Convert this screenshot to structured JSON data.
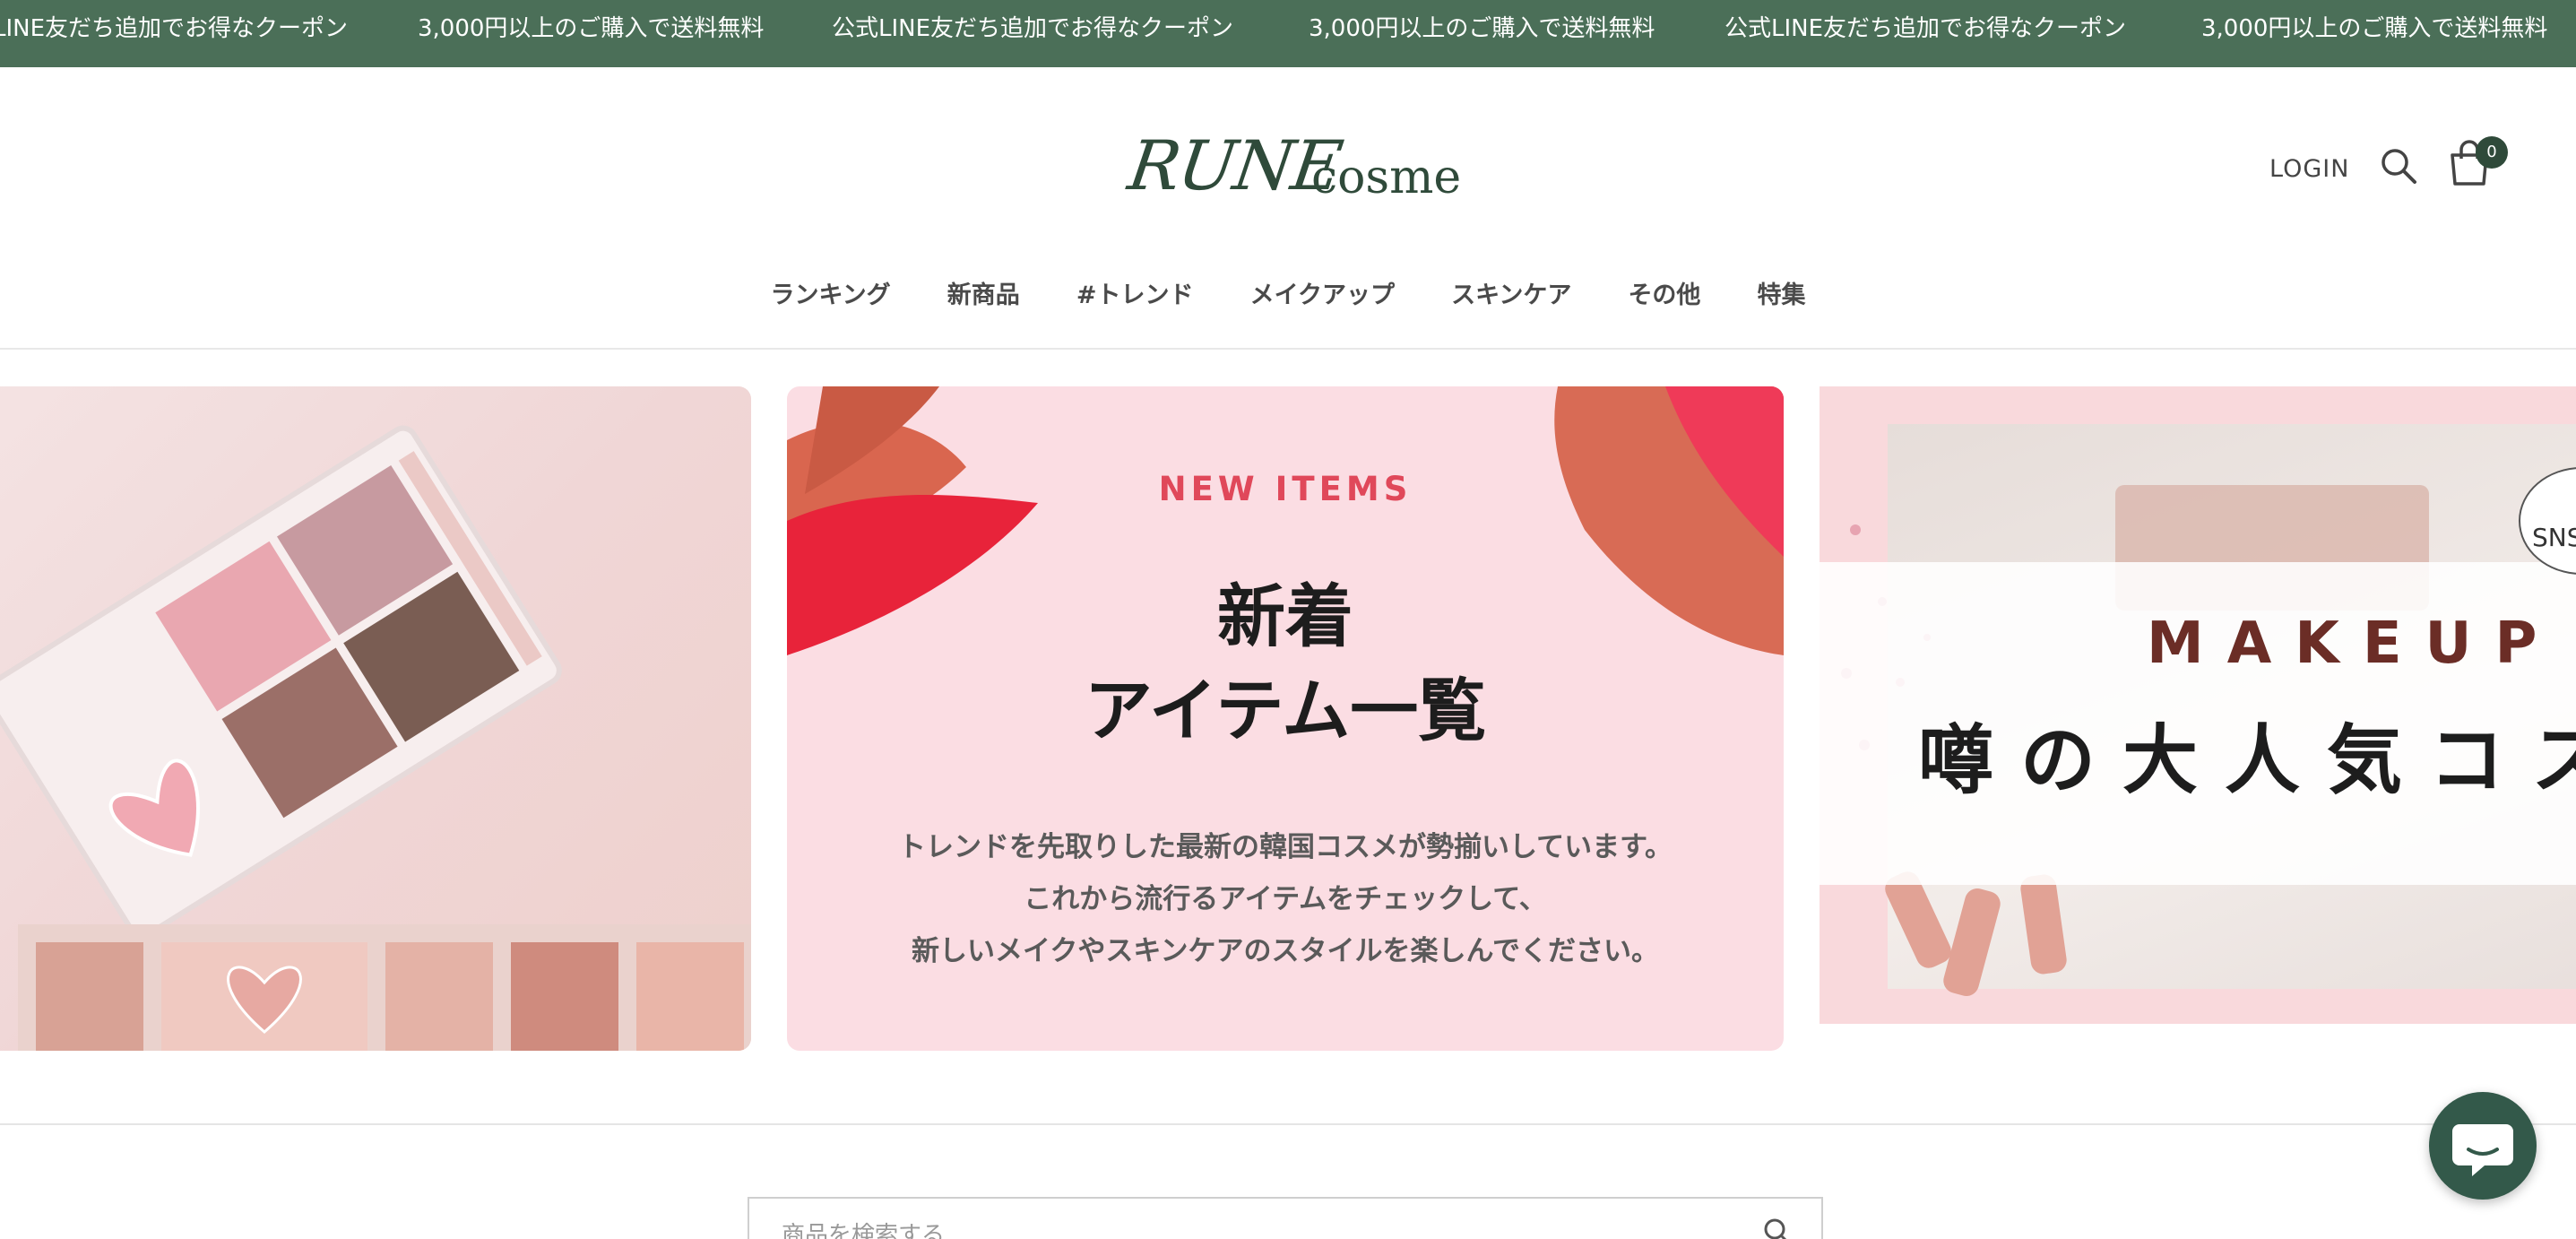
{
  "announcement": {
    "messages": [
      "LINE友だち追加でお得なクーポン",
      "3,000円以上のご購入で送料無料",
      "公式LINE友だち追加でお得なクーポン",
      "3,000円以上のご購入で送料無料",
      "公式LINE友だち追加でお得なクーポン",
      "3,000円以上のご購入で送料無料"
    ],
    "background": "#4b6f58"
  },
  "header": {
    "logo_script": "RUNE",
    "logo_word": "cosme",
    "login_label": "LOGIN",
    "cart_count": "0",
    "icons": [
      "search-icon",
      "cart-icon"
    ]
  },
  "nav": {
    "items": [
      "ランキング",
      "新商品",
      "#トレンド",
      "メイクアップ",
      "スキンケア",
      "その他",
      "特集"
    ]
  },
  "carousel": {
    "slide2": {
      "label": "NEW ITEMS",
      "title_line1": "新着",
      "title_line2": "アイテム一覧",
      "desc_line1": "トレンドを先取りした最新の韓国コスメが勢揃いしています。",
      "desc_line2": "これから流行るアイテムをチェックして、",
      "desc_line3": "新しいメイクやスキンケアのスタイルを楽しんでください。"
    },
    "slide3": {
      "sns": "SNS",
      "heading": "MAKEUP",
      "subheading": "噂の大人気コス"
    }
  },
  "search": {
    "placeholder": "商品を検索する"
  },
  "colors": {
    "brand_green": "#2f4a3a",
    "accent_red": "#e0485a",
    "chat_green": "#33594a"
  }
}
